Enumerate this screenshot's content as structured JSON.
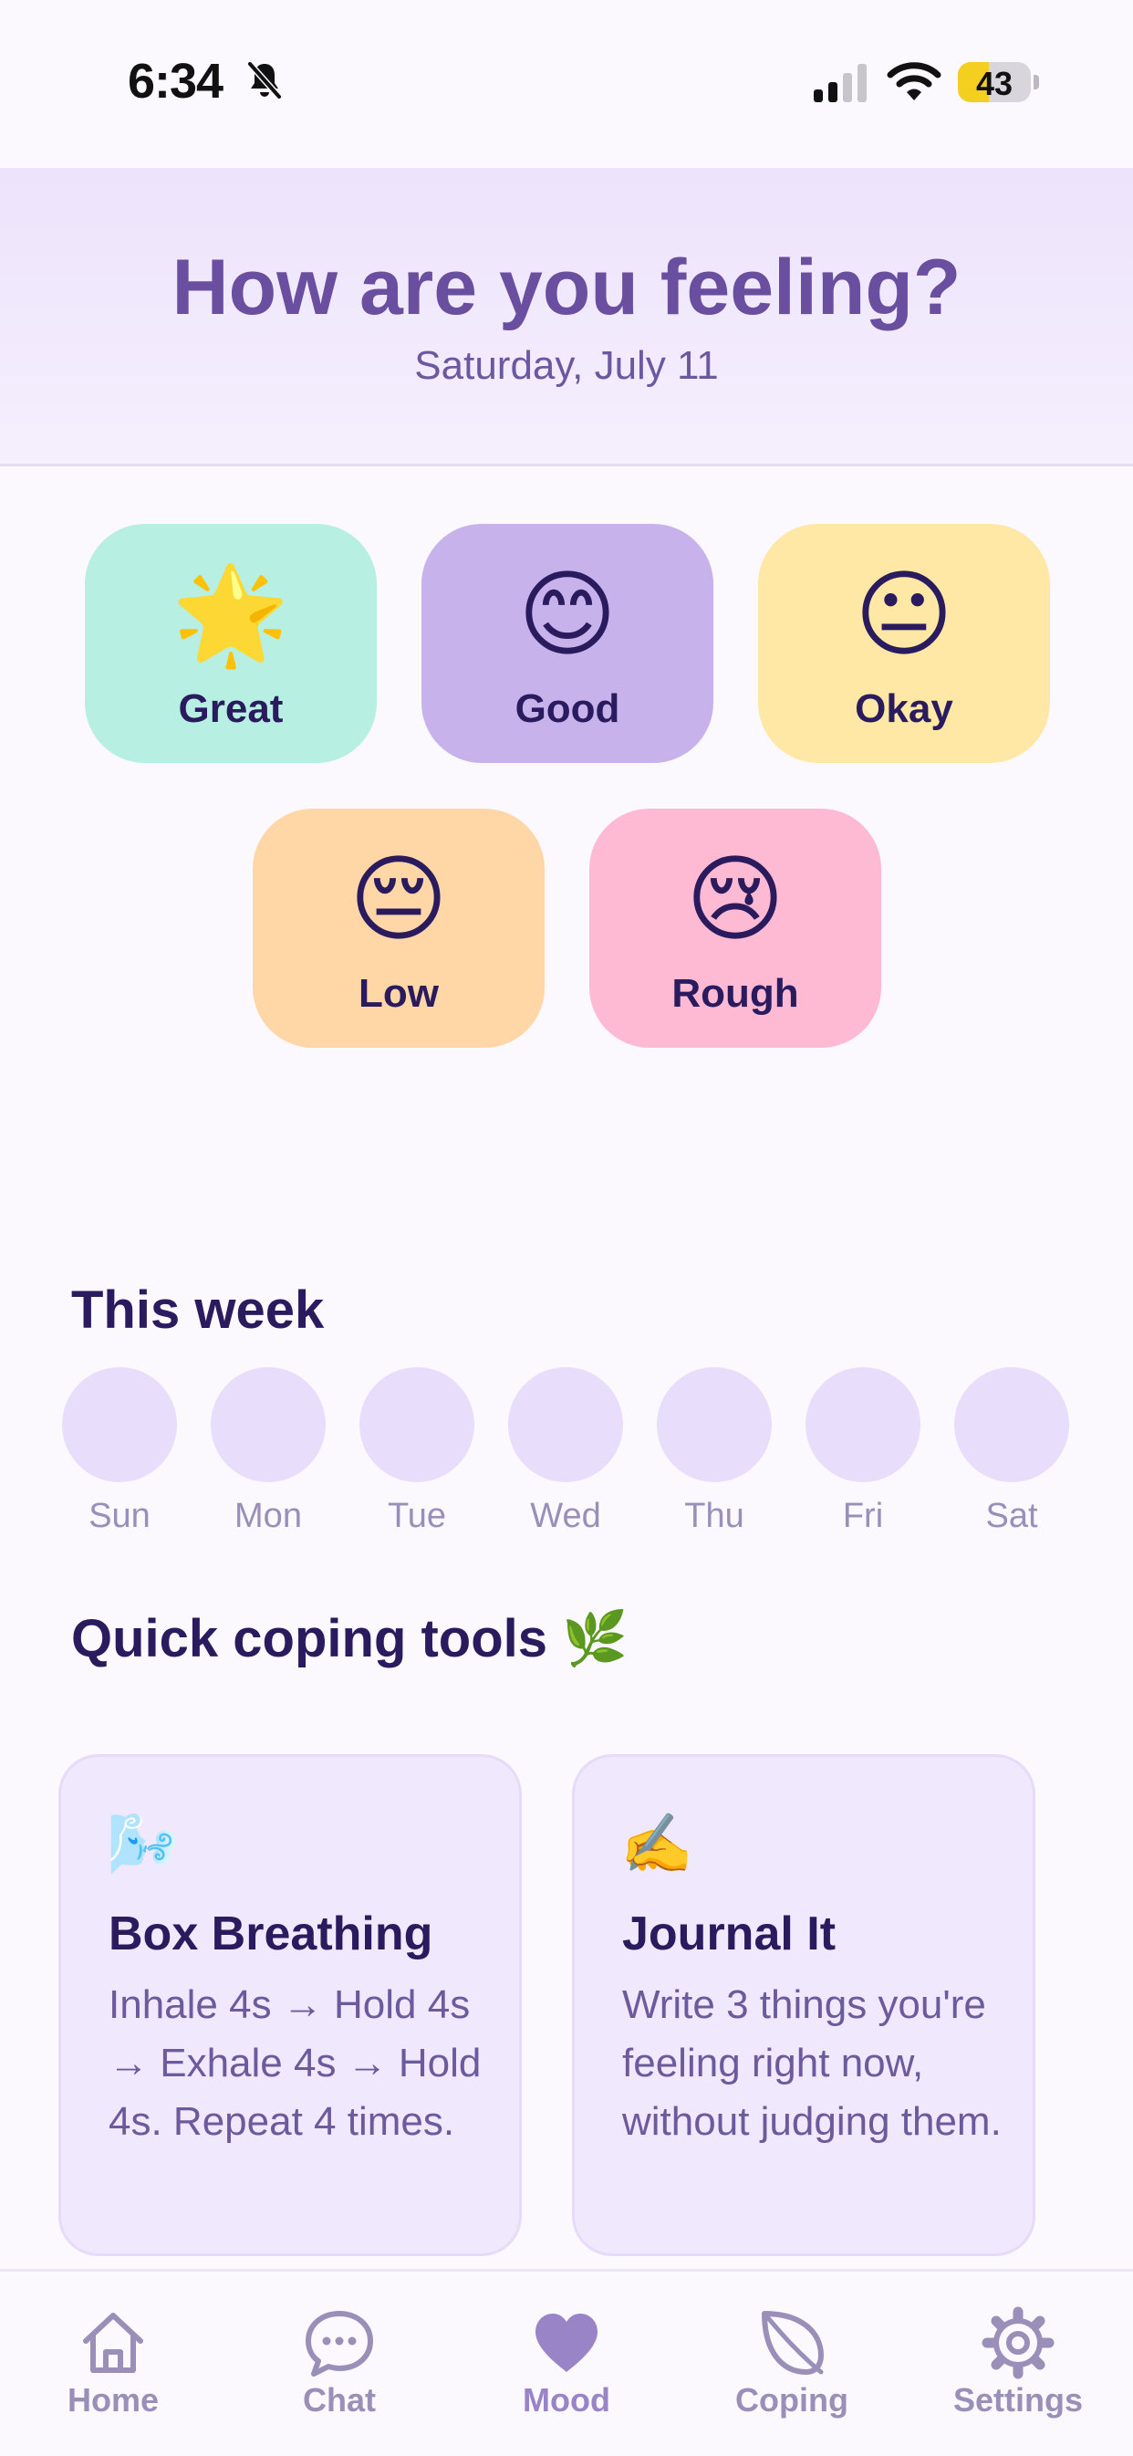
{
  "status": {
    "time": "6:34",
    "battery": 43
  },
  "header": {
    "title": "How are you feeling?",
    "date": "Saturday, July 11"
  },
  "moods": [
    {
      "emoji": "🌟",
      "label": "Great",
      "color": "#b7efe2"
    },
    {
      "emoji": "😊",
      "label": "Good",
      "color": "#c7b2ec"
    },
    {
      "emoji": "😐",
      "label": "Okay",
      "color": "#ffe8a6"
    },
    {
      "emoji": "😔",
      "label": "Low",
      "color": "#ffd6a6"
    },
    {
      "emoji": "😢",
      "label": "Rough",
      "color": "#ffbad3"
    }
  ],
  "week": {
    "title": "This week",
    "days": [
      "Sun",
      "Mon",
      "Tue",
      "Wed",
      "Thu",
      "Fri",
      "Sat"
    ]
  },
  "coping": {
    "title": "Quick coping tools 🌿",
    "tools": [
      {
        "icon": "🌬️",
        "title": "Box Breathing",
        "desc": "Inhale 4s → Hold 4s → Exhale 4s → Hold 4s. Repeat 4 times."
      },
      {
        "icon": "✍️",
        "title": "Journal It",
        "desc": "Write 3 things you're feeling right now, without judging them."
      }
    ]
  },
  "tabs": [
    {
      "label": "Home",
      "icon": "home-icon"
    },
    {
      "label": "Chat",
      "icon": "chat-icon"
    },
    {
      "label": "Mood",
      "icon": "heart-icon",
      "active": true
    },
    {
      "label": "Coping",
      "icon": "leaf-icon"
    },
    {
      "label": "Settings",
      "icon": "gear-icon"
    }
  ],
  "colors": {
    "accent": "#6a4fa0",
    "active_tab": "#9a84c8",
    "inactive_tab": "#9a8fb8",
    "day_circle": "#e8ddfb"
  }
}
